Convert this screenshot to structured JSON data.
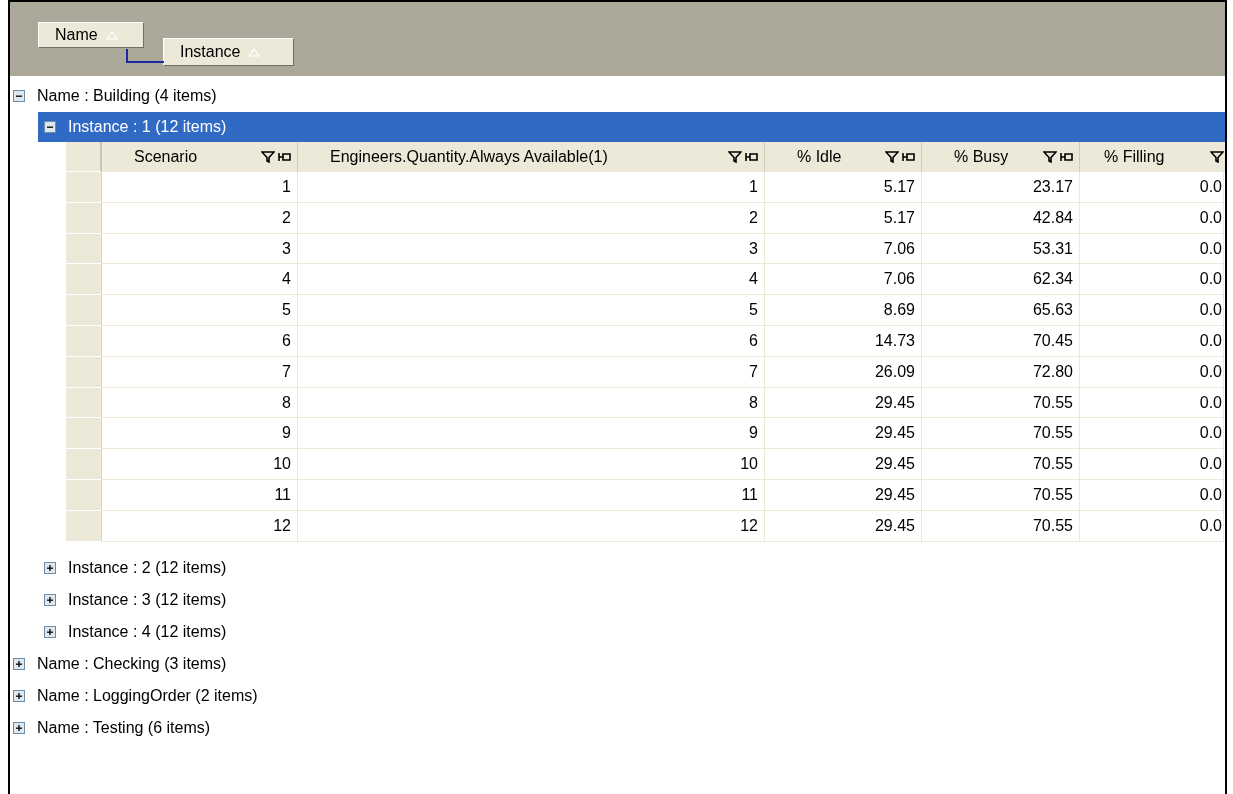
{
  "group_by_panel": {
    "fields": [
      {
        "label": "Name",
        "sort_ascending": true
      },
      {
        "label": "Instance",
        "sort_ascending": true
      }
    ]
  },
  "tree": [
    {
      "label": "Name : Building (4 items)",
      "expanded": true,
      "selected": false,
      "children": [
        {
          "label": "Instance : 1 (12 items)",
          "expanded": true,
          "selected": true,
          "table": {
            "columns": [
              "Scenario",
              "Engineers.Quantity.Always  Available(1)",
              "% Idle",
              "% Busy",
              "% Filling"
            ],
            "rows": [
              [
                "1",
                "1",
                "5.17",
                "23.17",
                "0.0"
              ],
              [
                "2",
                "2",
                "5.17",
                "42.84",
                "0.0"
              ],
              [
                "3",
                "3",
                "7.06",
                "53.31",
                "0.0"
              ],
              [
                "4",
                "4",
                "7.06",
                "62.34",
                "0.0"
              ],
              [
                "5",
                "5",
                "8.69",
                "65.63",
                "0.0"
              ],
              [
                "6",
                "6",
                "14.73",
                "70.45",
                "0.0"
              ],
              [
                "7",
                "7",
                "26.09",
                "72.80",
                "0.0"
              ],
              [
                "8",
                "8",
                "29.45",
                "70.55",
                "0.0"
              ],
              [
                "9",
                "9",
                "29.45",
                "70.55",
                "0.0"
              ],
              [
                "10",
                "10",
                "29.45",
                "70.55",
                "0.0"
              ],
              [
                "11",
                "11",
                "29.45",
                "70.55",
                "0.0"
              ],
              [
                "12",
                "12",
                "29.45",
                "70.55",
                "0.0"
              ]
            ]
          }
        },
        {
          "label": "Instance : 2 (12 items)",
          "expanded": false,
          "selected": false
        },
        {
          "label": "Instance : 3 (12 items)",
          "expanded": false,
          "selected": false
        },
        {
          "label": "Instance : 4 (12 items)",
          "expanded": false,
          "selected": false
        }
      ]
    },
    {
      "label": "Name : Checking (3 items)",
      "expanded": false,
      "selected": false
    },
    {
      "label": "Name : LoggingOrder (2 items)",
      "expanded": false,
      "selected": false
    },
    {
      "label": "Name : Testing (6 items)",
      "expanded": false,
      "selected": false
    }
  ]
}
